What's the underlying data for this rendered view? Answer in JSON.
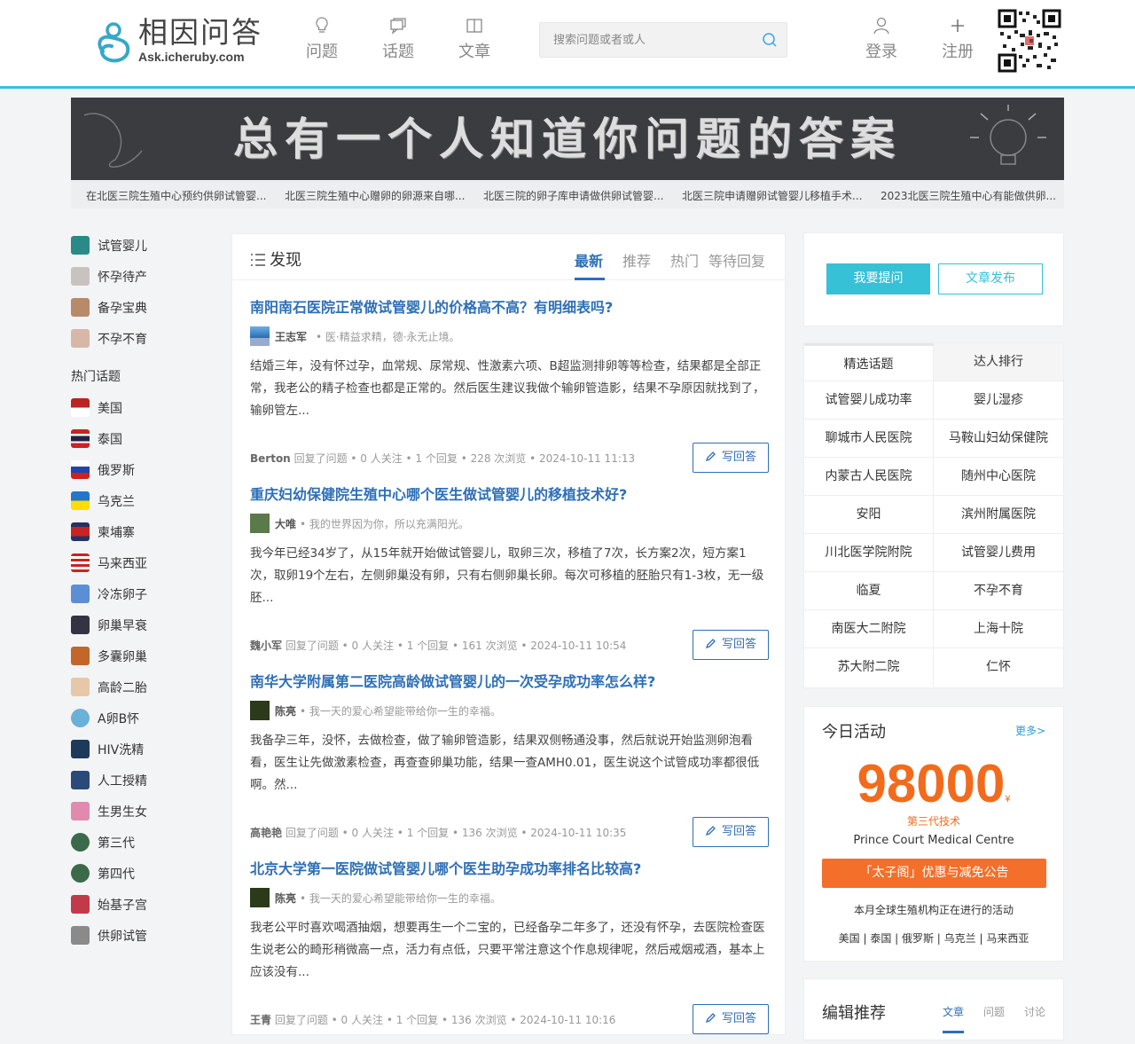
{
  "header": {
    "logo_title": "相因问答",
    "logo_sub": "Ask.icheruby.com",
    "nav": [
      {
        "label": "问题",
        "icon": "lightbulb-icon"
      },
      {
        "label": "话题",
        "icon": "chat-icon"
      },
      {
        "label": "文章",
        "icon": "book-icon"
      }
    ],
    "search_placeholder": "搜索问题或者或人",
    "login": "登录",
    "register": "注册"
  },
  "banner": {
    "text": "总有一个人知道你问题的答案",
    "ticker": [
      "在北医三院生殖中心预约供卵试管婴...",
      "北医三院生殖中心赠卵的卵源来自哪...",
      "北医三院的卵子库申请做供卵试管婴...",
      "北医三院申请赠卵试管婴儿移植手术...",
      "2023北医三院生殖中心有能做供卵..."
    ]
  },
  "left_nav": {
    "categories": [
      "试管婴儿",
      "怀孕待产",
      "备孕宝典",
      "不孕不育"
    ],
    "hot_topics_title": "热门话题",
    "hot_topics": [
      "美国",
      "泰国",
      "俄罗斯",
      "乌克兰",
      "柬埔寨",
      "马来西亚",
      "冷冻卵子",
      "卵巢早衰",
      "多囊卵巢",
      "高龄二胎",
      "A卵B怀",
      "HIV洗精",
      "人工授精",
      "生男生女",
      "第三代",
      "第四代",
      "始基子宫",
      "供卵试管"
    ]
  },
  "main": {
    "title": "发现",
    "tabs": [
      "最新",
      "推荐",
      "热门",
      "等待回复"
    ],
    "answer_label": "写回答",
    "questions": [
      {
        "title": "南阳南石医院正常做试管婴儿的价格高不高？有明细表吗?",
        "user": "王志军",
        "signature": "• 医·精益求精，德·永无止境。",
        "body": "结婚三年，没有怀过孕，血常规、尿常规、性激素六项、B超监测排卵等等检查，结果都是全部正常，我老公的精子检查也都是正常的。然后医生建议我做个输卵管造影，结果不孕原因就找到了，输卵管左...",
        "replier": "Berton",
        "meta": "回复了问题 • 0 人关注 • 1 个回复 • 228 次浏览 • 2024-10-11 11:13"
      },
      {
        "title": "重庆妇幼保健院生殖中心哪个医生做试管婴儿的移植技术好?",
        "user": "大唯",
        "signature": "• 我的世界因为你，所以充满阳光。",
        "body": "我今年已经34岁了，从15年就开始做试管婴儿，取卵三次，移植了7次，长方案2次，短方案1次，取卵19个左右，左侧卵巢没有卵，只有右侧卵巢长卵。每次可移植的胚胎只有1-3枚，无一级胚...",
        "replier": "魏小军",
        "meta": "回复了问题 • 0 人关注 • 1 个回复 • 161 次浏览 • 2024-10-11 10:54"
      },
      {
        "title": "南华大学附属第二医院高龄做试管婴儿的一次受孕成功率怎么样?",
        "user": "陈亮",
        "signature": "• 我一天的爱心希望能带给你一生的幸福。",
        "body": "我备孕三年，没怀，去做检查，做了输卵管造影，结果双侧畅通没事，然后就说开始监测卵泡看看，医生让先做激素检查，再查查卵巢功能，结果一查AMH0.01，医生说这个试管成功率都很低啊。然...",
        "replier": "高艳艳",
        "meta": "回复了问题 • 0 人关注 • 1 个回复 • 136 次浏览 • 2024-10-11 10:35"
      },
      {
        "title": "北京大学第一医院做试管婴儿哪个医生助孕成功率排名比较高?",
        "user": "陈亮",
        "signature": "• 我一天的爱心希望能带给你一生的幸福。",
        "body": "我老公平时喜欢喝酒抽烟，想要再生一个二宝的，已经备孕二年多了，还没有怀孕，去医院检查医生说老公的畸形稍微高一点，活力有点低，只要平常注意这个作息规律呢，然后戒烟戒酒，基本上应该没有...",
        "replier": "王青",
        "meta": "回复了问题 • 0 人关注 • 1 个回复 • 136 次浏览 • 2024-10-11 10:16"
      }
    ]
  },
  "right": {
    "ask_label": "我要提问",
    "post_label": "文章发布",
    "grid_tabs": [
      "精选话题",
      "达人排行"
    ],
    "grid_items": [
      "试管婴儿成功率",
      "婴儿湿疹",
      "聊城市人民医院",
      "马鞍山妇幼保健院",
      "内蒙古人民医院",
      "随州中心医院",
      "安阳",
      "滨州附属医院",
      "川北医学院附院",
      "试管婴儿费用",
      "临夏",
      "不孕不育",
      "南医大二附院",
      "上海十院",
      "苏大附二院",
      "仁怀"
    ],
    "activity": {
      "title": "今日活动",
      "more": "更多>",
      "amount": "98000",
      "currency": "¥",
      "subtitle": "第三代技术",
      "clinic": "Prince Court Medical Centre",
      "button": "「太子阁」优惠与减免公告",
      "note": "本月全球生殖机构正在进行的活动",
      "countries": "美国 | 泰国 | 俄罗斯 | 乌克兰 | 马来西亚"
    },
    "editor": {
      "title": "编辑推荐",
      "tabs": [
        "文章",
        "问题",
        "讨论"
      ]
    }
  },
  "colors": {
    "accent": "#36c1d6",
    "link": "#2e6fb7",
    "orange": "#f26b1d"
  }
}
